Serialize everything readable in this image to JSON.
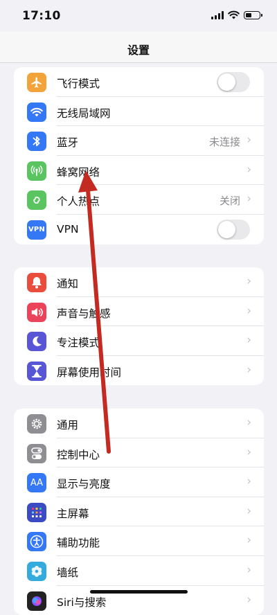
{
  "status": {
    "time": "17:10",
    "battery_level": 0.45
  },
  "nav": {
    "title": "设置"
  },
  "groups": [
    {
      "rows": [
        {
          "label": "飞行模式",
          "icon": "airplane-icon",
          "color": "#f2a33a",
          "control": "toggle",
          "toggle_on": false
        },
        {
          "label": "无线局域网",
          "icon": "wifi-icon",
          "color": "#3478f6",
          "control": "none"
        },
        {
          "label": "蓝牙",
          "icon": "bluetooth-icon",
          "color": "#3478f6",
          "value": "未连接",
          "control": "chevron"
        },
        {
          "label": "蜂窝网络",
          "icon": "antenna-icon",
          "color": "#5ac461",
          "control": "chevron"
        },
        {
          "label": "个人热点",
          "icon": "hotspot-icon",
          "color": "#5ac461",
          "value": "关闭",
          "control": "chevron"
        },
        {
          "label": "VPN",
          "icon": "vpn-icon",
          "icon_text": "VPN",
          "color": "#3478f6",
          "control": "toggle",
          "toggle_on": false
        }
      ]
    },
    {
      "rows": [
        {
          "label": "通知",
          "icon": "bell-icon",
          "color": "#eb4d3d",
          "control": "chevron"
        },
        {
          "label": "声音与触感",
          "icon": "speaker-icon",
          "color": "#eb445a",
          "control": "chevron"
        },
        {
          "label": "专注模式",
          "icon": "moon-icon",
          "color": "#5856d6",
          "control": "chevron"
        },
        {
          "label": "屏幕使用时间",
          "icon": "hourglass-icon",
          "color": "#5856d6",
          "control": "chevron"
        }
      ]
    },
    {
      "rows": [
        {
          "label": "通用",
          "icon": "gear-icon",
          "color": "#8e8e93",
          "control": "chevron"
        },
        {
          "label": "控制中心",
          "icon": "switches-icon",
          "color": "#8e8e93",
          "control": "chevron"
        },
        {
          "label": "显示与亮度",
          "icon": "text-size-icon",
          "icon_text": "AA",
          "color": "#3478f6",
          "control": "chevron"
        },
        {
          "label": "主屏幕",
          "icon": "home-grid-icon",
          "color": "#3b4bc4",
          "control": "chevron"
        },
        {
          "label": "辅助功能",
          "icon": "accessibility-icon",
          "color": "#3478f6",
          "control": "chevron"
        },
        {
          "label": "墙纸",
          "icon": "flower-icon",
          "color": "#35aadc",
          "control": "chevron"
        },
        {
          "label": "Siri与搜索",
          "icon": "siri-icon",
          "color": "#222222",
          "control": "chevron"
        }
      ]
    }
  ],
  "annotation": {
    "type": "arrow",
    "color": "#c32a22"
  }
}
